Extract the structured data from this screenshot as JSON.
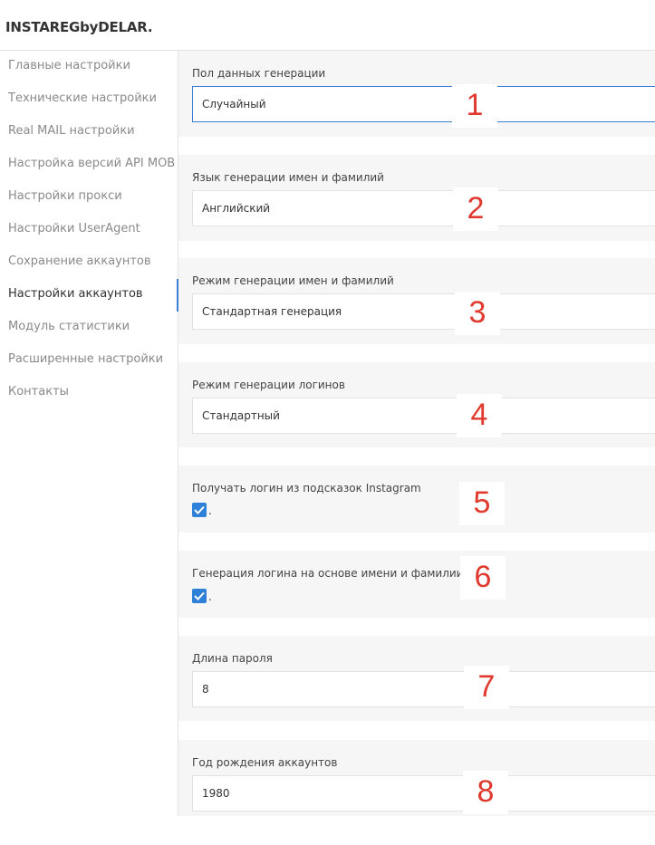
{
  "app": {
    "brand": "INSTAREGbyDELAR."
  },
  "sidebar": {
    "items": [
      {
        "label": "Главные настройки"
      },
      {
        "label": "Технические настройки"
      },
      {
        "label": "Real MAIL настройки"
      },
      {
        "label": "Настройка версий API MOB"
      },
      {
        "label": "Настройки прокси"
      },
      {
        "label": "Настройки UserAgent"
      },
      {
        "label": "Сохранение аккаунтов"
      },
      {
        "label": "Настройки аккаунтов",
        "active": true
      },
      {
        "label": "Модуль статистики"
      },
      {
        "label": "Расширенные настройки"
      },
      {
        "label": "Контакты"
      }
    ]
  },
  "settings": [
    {
      "label": "Пол данных генерации",
      "type": "select",
      "value": "Случайный",
      "marker": "1"
    },
    {
      "label": "Язык генерации имен и фамилий",
      "type": "select",
      "value": "Английский",
      "marker": "2"
    },
    {
      "label": "Режим генерации имен и фамилий",
      "type": "select",
      "value": "Стандартная генерация",
      "marker": "3"
    },
    {
      "label": "Режим генерации логинов",
      "type": "select",
      "value": "Стандартный",
      "marker": "4"
    },
    {
      "label": "Получать логин из подсказок Instagram",
      "type": "checkbox",
      "checked": true,
      "suffix": ".",
      "marker": "5"
    },
    {
      "label": "Генерация логина на основе имени и фамилии",
      "type": "checkbox",
      "checked": true,
      "suffix": ".",
      "marker": "6"
    },
    {
      "label": "Длина пароля",
      "type": "input",
      "value": "8",
      "marker": "7"
    },
    {
      "label": "Год рождения аккаунтов",
      "type": "input",
      "value": "1980",
      "marker": "8"
    }
  ],
  "colors": {
    "accent": "#2f80d8",
    "marker": "#e03a2f",
    "card_bg": "#f6f6f6"
  }
}
